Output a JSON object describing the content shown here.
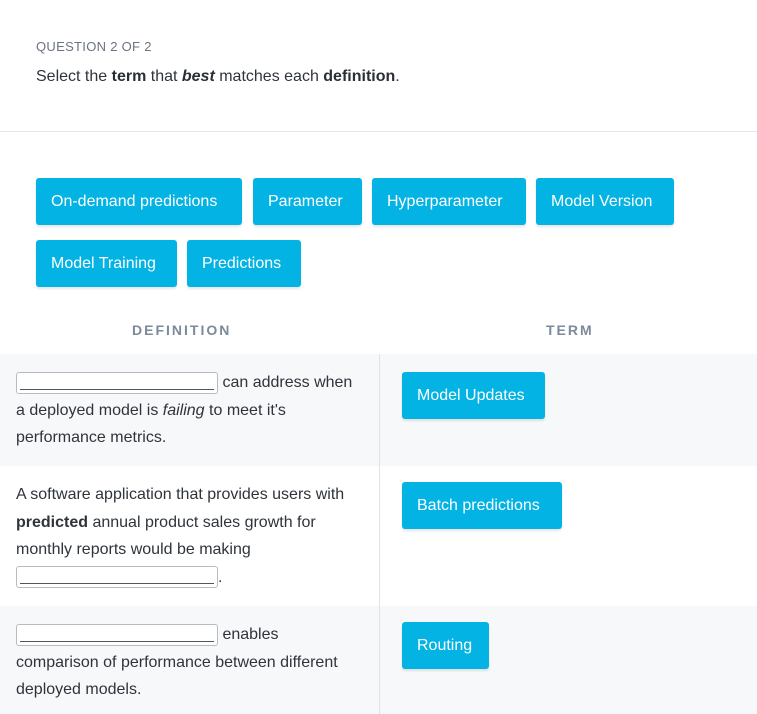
{
  "question": {
    "counter": "QUESTION 2 OF 2",
    "prompt_select": "Select the ",
    "prompt_term": "term",
    "prompt_that": " that ",
    "prompt_best": "best",
    "prompt_matches": " matches each ",
    "prompt_definition": "definition",
    "prompt_end": "."
  },
  "term_bank": [
    "On-demand predictions",
    "Parameter",
    "Hyperparameter",
    "Model Version",
    "Model Training",
    "Predictions"
  ],
  "columns": {
    "definition": "DEFINITION",
    "term": "TERM"
  },
  "rows": [
    {
      "def_after_blank": "can address when",
      "def_line2_pre": "a deployed model is ",
      "def_line2_em": "failing",
      "def_line2_post": " to meet it's",
      "def_line3": "performance metrics.",
      "term": "Model Updates"
    },
    {
      "def_pre": "A software application that provides users with ",
      "def_strong": "predicted",
      "def_post": " annual product sales growth for monthly reports would be making",
      "def_end": ".",
      "term": "Batch predictions"
    },
    {
      "def_after_blank": "enables",
      "def_rest": "comparison of performance between different deployed models.",
      "term": "Routing"
    }
  ]
}
